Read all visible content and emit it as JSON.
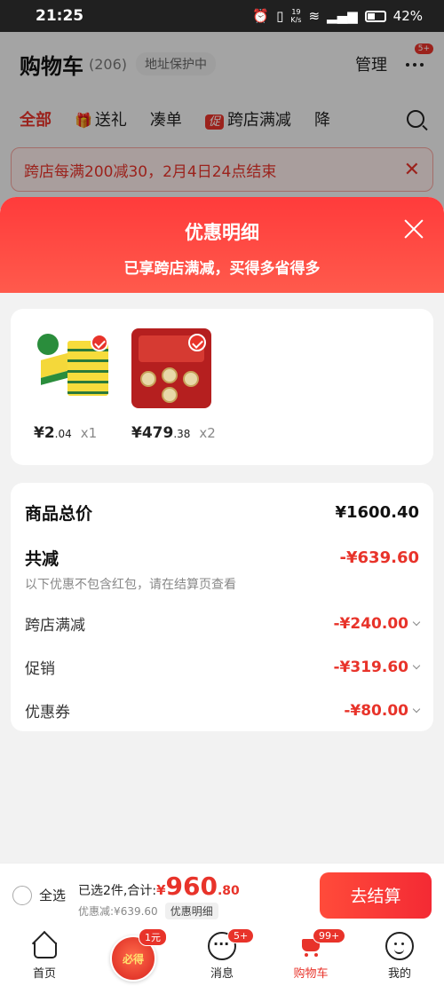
{
  "status_bar": {
    "time": "21:25",
    "net_speed": "19",
    "net_unit": "K/s",
    "battery": "42%"
  },
  "cart_header": {
    "title": "购物车",
    "count": "(206)",
    "address_protection": "地址保护中",
    "manage": "管理",
    "more_badge": "5+"
  },
  "category_tabs": [
    {
      "label": "全部"
    },
    {
      "label": "送礼"
    },
    {
      "label": "凑单"
    },
    {
      "tag": "促",
      "label": "跨店满减"
    },
    {
      "label": "降"
    }
  ],
  "promo_banner": {
    "text": "跨店每满200减30，2月4日24点结束"
  },
  "sheet": {
    "title": "优惠明细",
    "subtitle": "已享跨店满减，买得多省得多"
  },
  "products": [
    {
      "name": "sponge",
      "price_int": "¥2",
      "price_dec": ".04",
      "qty": "x1"
    },
    {
      "name": "gift-box",
      "price_int": "¥479",
      "price_dec": ".38",
      "qty": "x2"
    }
  ],
  "summary": {
    "total_label": "商品总价",
    "total_value": "¥1600.40",
    "reduce_label": "共减",
    "reduce_value": "-¥639.60",
    "note": "以下优惠不包含红包，请在结算页查看",
    "items": [
      {
        "label": "跨店满减",
        "value": "-¥240.00"
      },
      {
        "label": "促销",
        "value": "-¥319.60"
      },
      {
        "label": "优惠券",
        "value": "-¥80.00"
      }
    ]
  },
  "checkout": {
    "select_all": "全选",
    "selected_text": "已选2件,合计:",
    "currency": "¥",
    "total_int": "960",
    "total_dec": ".80",
    "discount_text": "优惠减:¥639.60",
    "detail_chip": "优惠明细",
    "pay_button": "去结算"
  },
  "tabbar": [
    {
      "label": "首页",
      "icon": "home-icon"
    },
    {
      "label": "",
      "icon": "promo-icon",
      "promo_text": "必得",
      "badge": "1元"
    },
    {
      "label": "消息",
      "icon": "message-icon",
      "badge": "5+"
    },
    {
      "label": "购物车",
      "icon": "cart-icon",
      "badge": "99+",
      "active": true
    },
    {
      "label": "我的",
      "icon": "profile-icon"
    }
  ],
  "colors": {
    "accent": "#e8332a",
    "sheet_header": "#ff3b3b"
  }
}
